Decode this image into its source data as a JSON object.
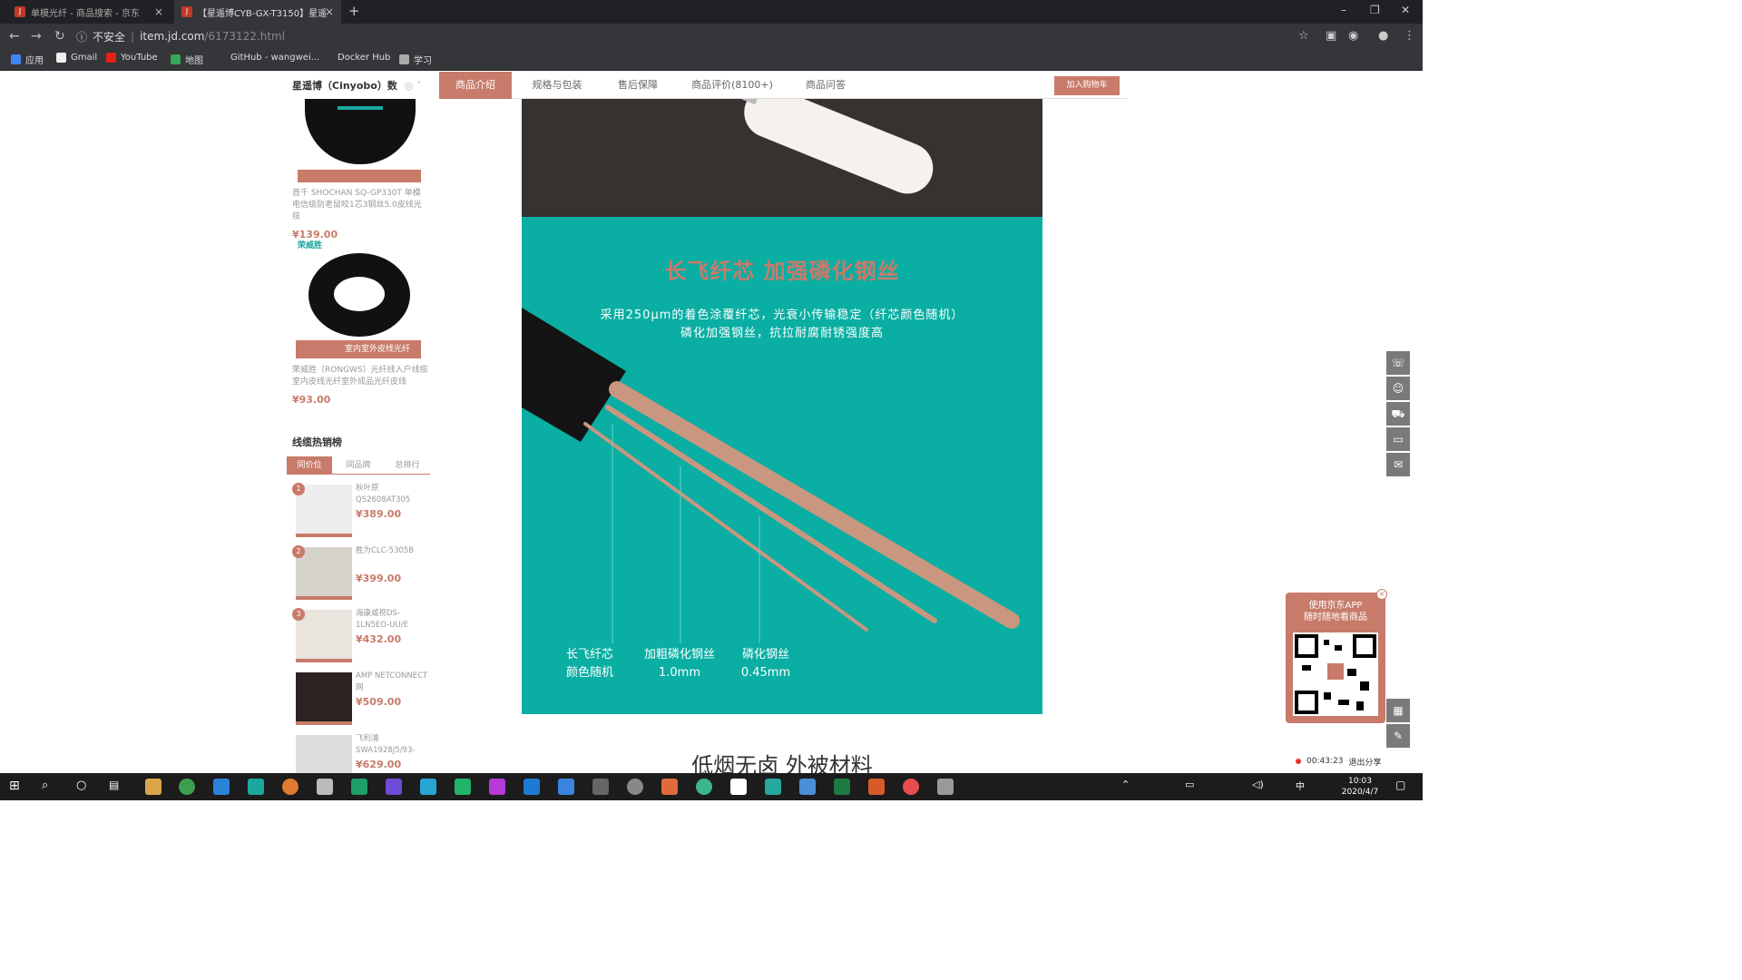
{
  "browser": {
    "tabs": [
      {
        "title": "单模光纤 - 商品搜索 - 京东",
        "close": "×"
      },
      {
        "title": "【星遥博CYB-GX-T3150】星遥",
        "close": "×"
      }
    ],
    "new_tab": "+",
    "window_controls": {
      "minimize": "–",
      "restore": "❐",
      "close": "✕"
    },
    "nav": {
      "back": "←",
      "forward": "→",
      "reload": "↻"
    },
    "address": {
      "security": "不安全",
      "domain": "item.jd.com",
      "path": "/6173122.html"
    },
    "bookmarks": [
      "应用",
      "Gmail",
      "YouTube",
      "地图",
      "GitHub - wangwei...",
      "Docker Hub",
      "学习"
    ]
  },
  "store": {
    "name": "星遥博（Cinyobo）数",
    "tabs": [
      "商品介绍",
      "规格与包装",
      "售后保障",
      "商品评价(8100+)",
      "商品问答"
    ],
    "active_tab": "商品介绍",
    "cart_button": "加入购物车"
  },
  "sidebar_products": [
    {
      "name": "首千 SHOCHAN SQ-GP330T 单模电信级防老鼠咬1芯3钢丝5.0皮线光缆",
      "price": "¥139.00",
      "banner": ""
    },
    {
      "name": "荣威胜（RONGWS）光纤线入户线缆室内皮线光纤室外成品光纤皮线",
      "price": "¥93.00",
      "banner": "室内室外皮线光纤",
      "brand": "荣威胜"
    }
  ],
  "ranking": {
    "title": "线缆热销榜",
    "tabs": [
      "同价位",
      "同品牌",
      "总排行"
    ],
    "active_tab": "同价位",
    "items": [
      {
        "rank": "1",
        "name": "秋叶原 QS2608AT305",
        "price": "¥389.00"
      },
      {
        "rank": "2",
        "name": "胜为CLC-5305B",
        "price": "¥399.00"
      },
      {
        "rank": "3",
        "name": "海康威视DS-1LN5EO-UU/E",
        "price": "¥432.00"
      },
      {
        "rank": "",
        "name": "AMP NETCONNECT网",
        "price": "¥509.00"
      },
      {
        "rank": "",
        "name": "飞利浦 SWA1928J5/93-",
        "price": "¥629.00"
      }
    ]
  },
  "feature": {
    "title": "长飞纤芯  加强磷化钢丝",
    "line1": "采用250μm的着色涂覆纤芯，光衰小传输稳定（纤芯颜色随机）",
    "line2": "磷化加强钢丝，抗拉耐腐耐锈强度高",
    "captions": [
      {
        "line1": "长飞纤芯",
        "line2": "颜色随机"
      },
      {
        "line1": "加粗磷化钢丝",
        "line2": "1.0mm"
      },
      {
        "line1": "磷化钢丝",
        "line2": "0.45mm"
      }
    ],
    "next_heading": "低烟无卤  外被材料"
  },
  "qr_promo": {
    "line1": "使用京东APP",
    "line2": "随时随地看商品",
    "close": "×"
  },
  "share": {
    "timer": "00:43:23",
    "exit": "退出分享"
  },
  "taskbar": {
    "time": "10:03",
    "date": "2020/4/7"
  },
  "colors": {
    "accent": "#c87b6a",
    "teal": "#0aaea3",
    "dark": "#373130"
  }
}
